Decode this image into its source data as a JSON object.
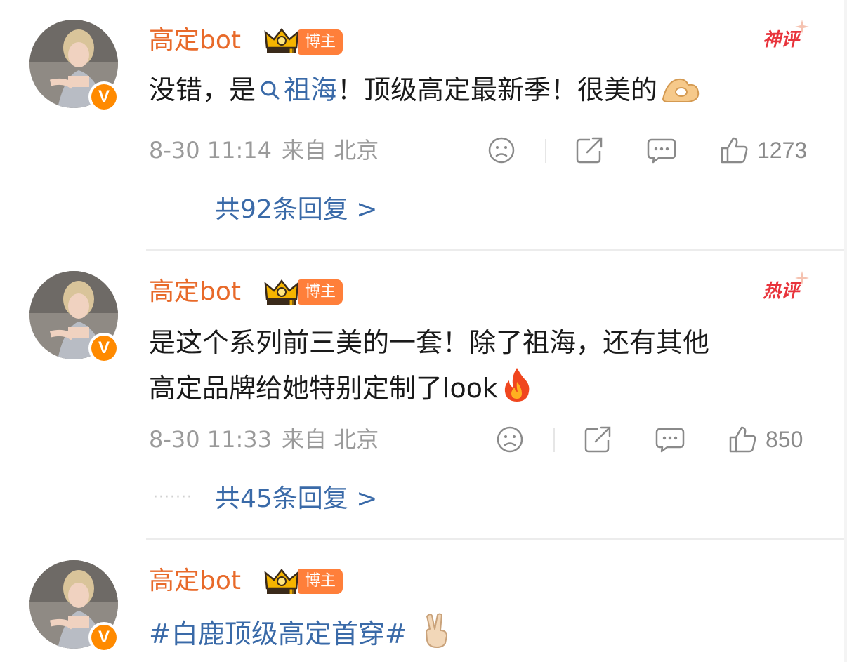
{
  "comments": [
    {
      "username": "高定bot",
      "blogger_tag": "博主",
      "verified_badge": "V",
      "hot_tag": "神评",
      "text_before": "没错，是",
      "topic": "祖海",
      "text_after": "！顶级高定最新季！很美的",
      "emoji": "ok-hand-emoji",
      "date": "8-30 11:14",
      "source": "来自 北京",
      "likes": "1273",
      "replies": "共92条回复 >"
    },
    {
      "username": "高定bot",
      "blogger_tag": "博主",
      "verified_badge": "V",
      "hot_tag": "热评",
      "text_line1": "是这个系列前三美的一套！除了祖海，还有其他",
      "text_line2": "高定品牌给她特别定制了look",
      "emoji": "fire-emoji",
      "date": "8-30 11:33",
      "source": "来自 北京",
      "likes": "850",
      "dots": "·······",
      "replies": "共45条回复 >"
    },
    {
      "username": "高定bot",
      "blogger_tag": "博主",
      "verified_badge": "V",
      "text": "#白鹿顶级高定首穿#",
      "emoji": "victory-hand-emoji"
    }
  ],
  "icons": {
    "dislike": "sad-face-icon",
    "share": "share-icon",
    "comment": "comment-bubble-icon",
    "like": "thumbs-up-icon"
  },
  "colors": {
    "username": "#e86a2a",
    "link": "#3a6aa8",
    "meta": "#9a9a9a",
    "hot_tag": "#e8343c",
    "verified": "#ff8a00"
  }
}
